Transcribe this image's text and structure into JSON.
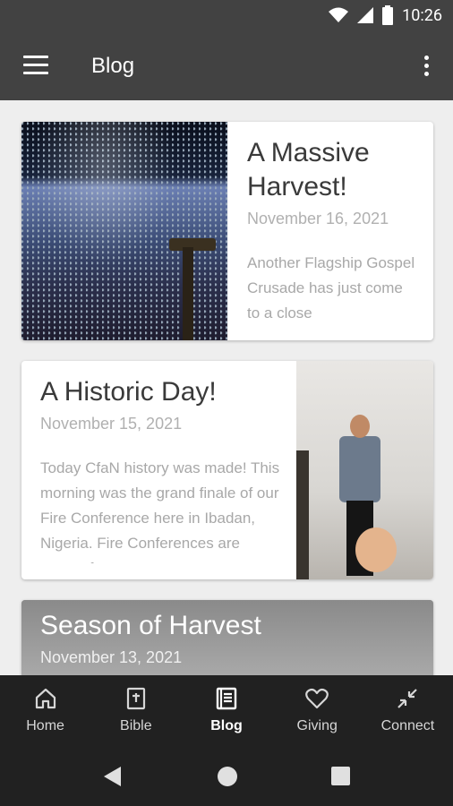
{
  "status": {
    "time": "10:26",
    "icons": [
      "wifi-icon",
      "signal-icon",
      "battery-icon"
    ]
  },
  "app_bar": {
    "title": "Blog",
    "menu_icon": "hamburger-menu-icon",
    "overflow_icon": "more-vert-icon"
  },
  "posts": [
    {
      "title": "A Massive Harvest!",
      "date": "November 16, 2021",
      "excerpt": "Another Flagship Gospel Crusade has just come to a close"
    },
    {
      "title": "A Historic Day!",
      "date": "November 15, 2021",
      "excerpt": "Today CfaN history was made! This morning was the grand finale of our Fire Conference here in Ibadan, Nigeria. Fire Conferences are events for"
    },
    {
      "title": "Season of Harvest",
      "date": "November 13, 2021"
    }
  ],
  "bottom_nav": {
    "active": "Blog",
    "items": [
      {
        "label": "Home",
        "icon": "home-icon"
      },
      {
        "label": "Bible",
        "icon": "bible-icon"
      },
      {
        "label": "Blog",
        "icon": "blog-book-icon"
      },
      {
        "label": "Giving",
        "icon": "heart-icon"
      },
      {
        "label": "Connect",
        "icon": "connect-arrows-icon"
      }
    ]
  },
  "colors": {
    "app_bar": "#424242",
    "nav_bar": "#212121",
    "background": "#eeeeee"
  }
}
